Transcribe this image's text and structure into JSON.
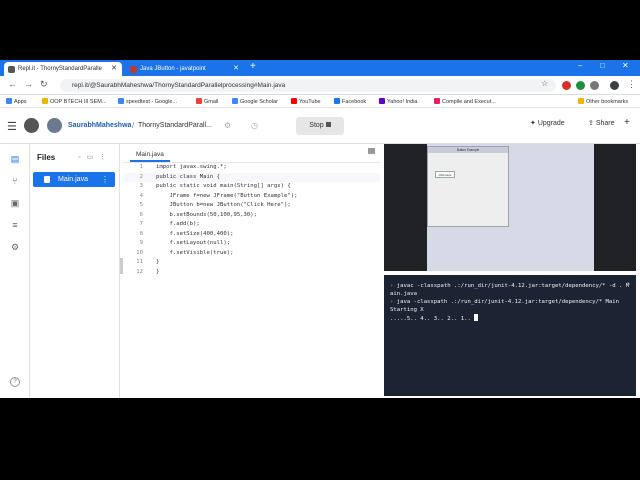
{
  "browser": {
    "tabs": [
      {
        "title": "Repl.it - ThornyStandardParalle",
        "favicon_color": "#555555"
      },
      {
        "title": "Java JButton - javatpoint",
        "favicon_color": "#c0392b"
      }
    ],
    "new_tab": "+",
    "window_controls": [
      "–",
      "□",
      "✕"
    ],
    "url": "repl.it/@SaurabhMaheshwa/ThornyStandardParallelprocessing#Main.java",
    "bookmarks": [
      {
        "label": "Apps",
        "color": "#4285f4"
      },
      {
        "label": "OOP BTECH III SEM...",
        "color": "#f4b400"
      },
      {
        "label": "speedtest - Google...",
        "color": "#4285f4"
      },
      {
        "label": "Gmail",
        "color": "#ea4335"
      },
      {
        "label": "Google Scholar",
        "color": "#4285f4"
      },
      {
        "label": "YouTube",
        "color": "#ff0000"
      },
      {
        "label": "Facebook",
        "color": "#1877f2"
      },
      {
        "label": "Yahoo! India",
        "color": "#6001d2"
      },
      {
        "label": "Compile and Execut...",
        "color": "#e91e63"
      },
      {
        "label": "Other bookmarks",
        "color": "#f4b400"
      }
    ]
  },
  "header": {
    "username": "SaurabhMaheshwa",
    "repl_name": "ThornyStandardParall...",
    "stop_label": "Stop",
    "upgrade_label": "Upgrade",
    "share_label": "Share"
  },
  "files": {
    "title": "Files",
    "items": [
      {
        "name": "Main.java"
      }
    ]
  },
  "editor": {
    "tab": "Main.java",
    "lines": [
      "import javax.swing.*;",
      "public class Main {",
      "public static void main(String[] args) {",
      "    JFrame f=new JFrame(\"Button Example\");",
      "    JButton b=new JButton(\"Click Here\");",
      "    b.setBounds(50,100,95,30);",
      "    f.add(b);",
      "    f.setSize(400,400);",
      "    f.setLayout(null);",
      "    f.setVisible(true);",
      "}",
      "}"
    ],
    "line_numbers": [
      "1",
      "2",
      "3",
      "4",
      "5",
      "6",
      "7",
      "8",
      "9",
      "10",
      "11",
      "12"
    ]
  },
  "output": {
    "window_title": "Button Example",
    "button_label": "Click Here"
  },
  "console": {
    "lines": [
      {
        "prompt": "› ",
        "text": "javac -classpath .:/run_dir/junit-4.12.jar:target/dependency/* -d . Main.java"
      },
      {
        "prompt": "› ",
        "text": "java -classpath .:/run_dir/junit-4.12.jar:target/dependency/* Main"
      },
      {
        "prompt": "",
        "text": "Starting X"
      },
      {
        "prompt": "",
        "text": ".....5.. 4.. 3.. 2.. 1.. "
      }
    ]
  }
}
